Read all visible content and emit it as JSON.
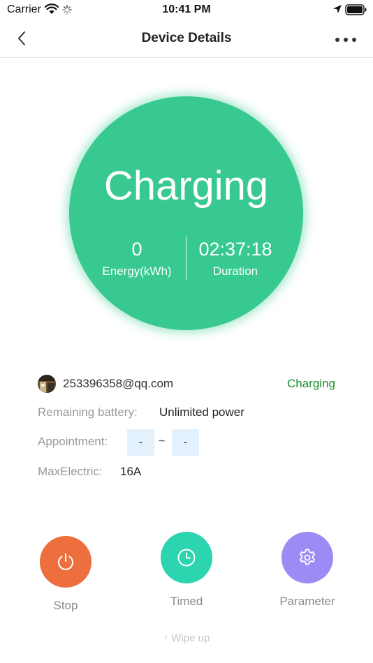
{
  "status_bar": {
    "carrier": "Carrier",
    "time": "10:41 PM"
  },
  "nav": {
    "title": "Device Details"
  },
  "charge": {
    "status": "Charging",
    "energy_value": "0",
    "energy_label": "Energy(kWh)",
    "duration_value": "02:37:18",
    "duration_label": "Duration",
    "color": "#37c98f"
  },
  "user": {
    "email": "253396358@qq.com",
    "status": "Charging",
    "status_color": "#1a8f2a"
  },
  "info": {
    "battery_label": "Remaining battery:",
    "battery_value": "Unlimited power",
    "appointment_label": "Appointment:",
    "appointment_start": "-",
    "appointment_separator": "~",
    "appointment_end": "-",
    "max_label": "MaxElectric:",
    "max_value": "16A"
  },
  "actions": {
    "stop_label": "Stop",
    "stop_icon": "power-icon",
    "stop_color": "#ec6f3d",
    "timed_label": "Timed",
    "timed_icon": "clock-icon",
    "timed_color": "#2dd4b0",
    "param_label": "Parameter",
    "param_icon": "gear-icon",
    "param_color": "#9b8cf5"
  },
  "footer": {
    "hint": "↑ Wipe up"
  }
}
